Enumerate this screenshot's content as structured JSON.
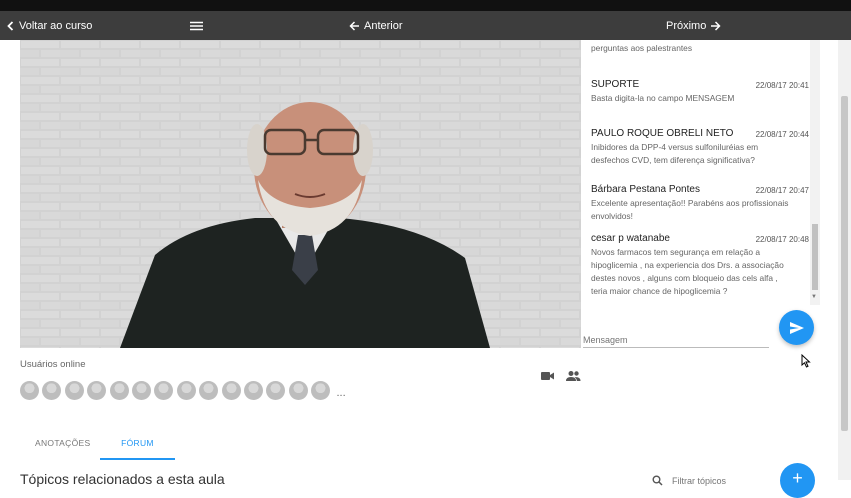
{
  "nav": {
    "back_label": "Voltar ao curso",
    "prev_label": "Anterior",
    "next_label": "Próximo"
  },
  "chat": {
    "messages": [
      {
        "author": "",
        "time": "",
        "text": "perguntas aos palestrantes"
      },
      {
        "author": "SUPORTE",
        "time": "22/08/17 20:41",
        "text": "Basta digita-la no campo MENSAGEM"
      },
      {
        "author": "PAULO ROQUE OBRELI NETO",
        "time": "22/08/17 20:44",
        "text": "Inibidores da DPP-4 versus sulfoniluréias em desfechos CVD, tem diferença significativa?"
      },
      {
        "author": "Bárbara Pestana Pontes",
        "time": "22/08/17 20:47",
        "text": "Excelente apresentação!! Parabéns aos profissionais envolvidos!"
      },
      {
        "author": "cesar p watanabe",
        "time": "22/08/17 20:48",
        "text": "Novos farmacos tem segurança em relação a hipoglicemia , na experiencia dos Drs. a associação destes novos , alguns com bloqueio das cels alfa , teria maior chance de hipoglicemia ?"
      }
    ],
    "input_placeholder": "Mensagem"
  },
  "online": {
    "label": "Usuários online",
    "avatar_count": 14,
    "more": "..."
  },
  "tabs": {
    "notes_label": "ANOTAÇÕES",
    "forum_label": "FÓRUM",
    "active": "forum"
  },
  "forum": {
    "heading": "Tópicos relacionados a esta aula",
    "filter_placeholder": "Filtrar tópicos",
    "add_label": "+"
  },
  "colors": {
    "accent": "#2196f3",
    "navbar": "#3d3d3d"
  },
  "icons": [
    "chevron-left-icon",
    "menu-icon",
    "arrow-left-icon",
    "arrow-right-icon",
    "send-icon",
    "videocam-icon",
    "people-icon",
    "search-icon",
    "mouse-cursor-icon"
  ]
}
